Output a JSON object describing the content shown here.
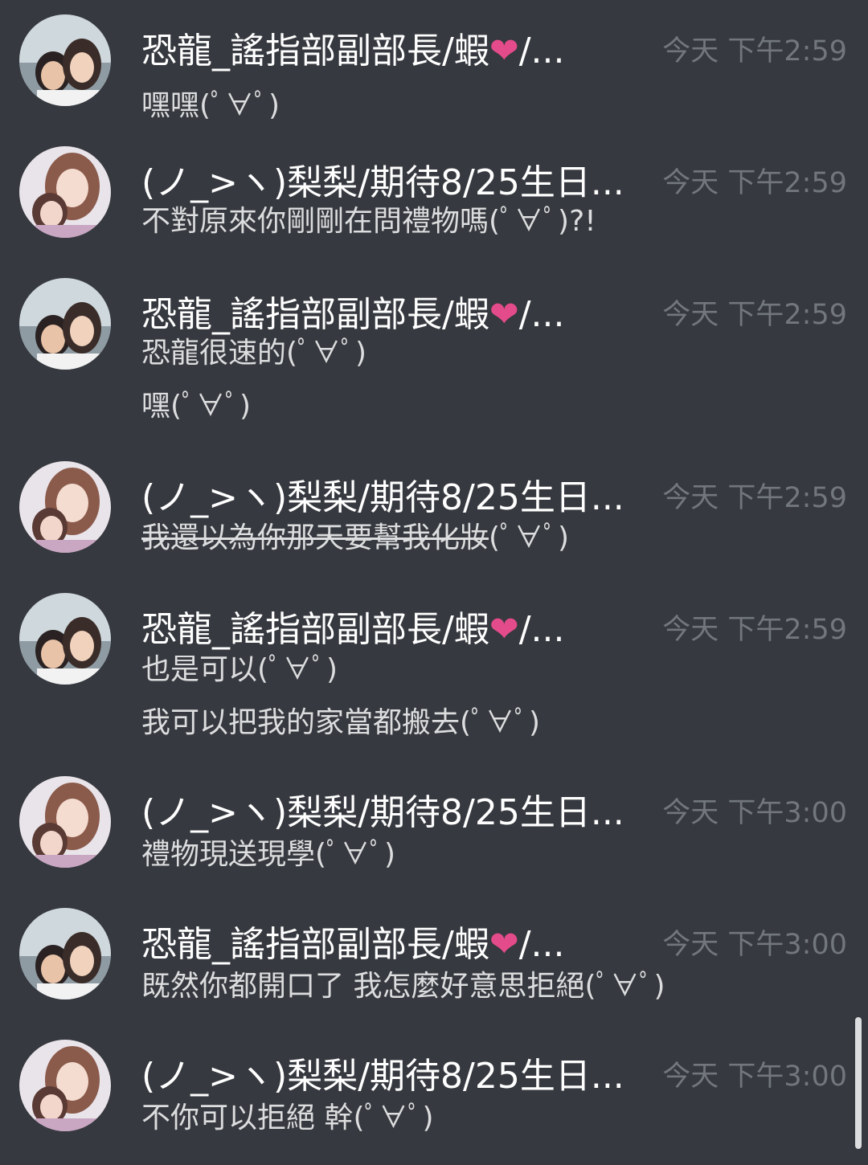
{
  "colors": {
    "background": "#36393f",
    "username": "#ffffff",
    "message_text": "#dcddde",
    "timestamp": "#72767d",
    "heart": "#e44b8a"
  },
  "users": {
    "u1": {
      "name": "恐龍_謠指部副部長/蝦",
      "heart": "❤",
      "suffix": "/..."
    },
    "u2": {
      "name": "(ノ_>ヽ)梨梨/期待8/25生日..."
    }
  },
  "groups": [
    {
      "user": "u1",
      "timestamp": "今天 下午2:59",
      "lines": [
        "嘿嘿(ﾟ∀ﾟ)"
      ]
    },
    {
      "user": "u2",
      "timestamp": "今天 下午2:59",
      "lines": [
        "不對原來你剛剛在問禮物嗎(ﾟ∀ﾟ)?!"
      ]
    },
    {
      "user": "u1",
      "timestamp": "今天 下午2:59",
      "lines": [
        "恐龍很速的(ﾟ∀ﾟ)",
        "嘿(ﾟ∀ﾟ)"
      ]
    },
    {
      "user": "u2",
      "timestamp": "今天 下午2:59",
      "lines": [
        "我還以為你那天要幫我化妝(ﾟ∀ﾟ)"
      ],
      "strike_part": "我還以為你那天要幫我化妝",
      "rest_part": "(ﾟ∀ﾟ)"
    },
    {
      "user": "u1",
      "timestamp": "今天 下午2:59",
      "lines": [
        "也是可以(ﾟ∀ﾟ)",
        "我可以把我的家當都搬去(ﾟ∀ﾟ)"
      ]
    },
    {
      "user": "u2",
      "timestamp": "今天 下午3:00",
      "lines": [
        "禮物現送現學(ﾟ∀ﾟ)"
      ]
    },
    {
      "user": "u1",
      "timestamp": "今天 下午3:00",
      "lines": [
        "既然你都開口了 我怎麼好意思拒絕(ﾟ∀ﾟ)"
      ]
    },
    {
      "user": "u2",
      "timestamp": "今天 下午3:00",
      "lines": [
        "不你可以拒絕 幹(ﾟ∀ﾟ)"
      ]
    }
  ],
  "scroll_position_percent": 100
}
